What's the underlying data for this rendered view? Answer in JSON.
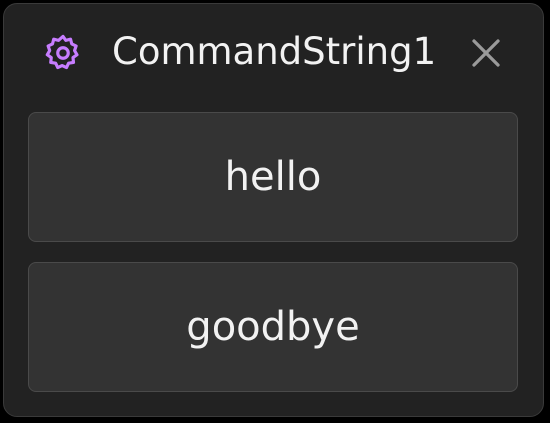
{
  "panel": {
    "title": "CommandString1",
    "icon": "gear-icon",
    "close_icon": "close-icon",
    "accent_color": "#c77dff"
  },
  "buttons": [
    {
      "label": "hello"
    },
    {
      "label": "goodbye"
    }
  ]
}
